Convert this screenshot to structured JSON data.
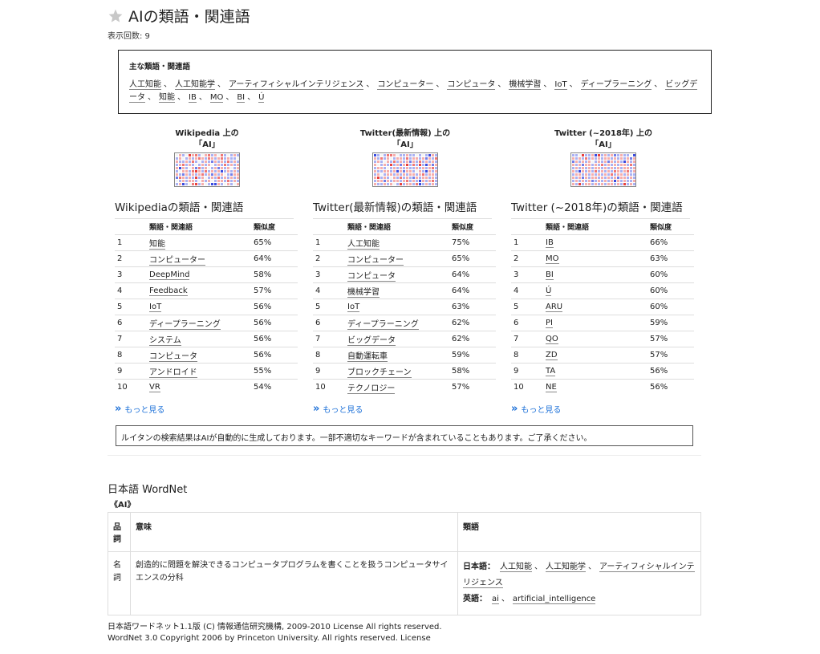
{
  "header": {
    "title": "AIの類語・関連語",
    "views_label": "表示回数: 9",
    "star_icon": "star-icon"
  },
  "main_synonyms": {
    "heading": "主な類語・関連語",
    "words": [
      "人工知能",
      "人工知能学",
      "アーティフィシャルインテリジェンス",
      "コンピューター",
      "コンピュータ",
      "機械学習",
      "IoT",
      "ディープラーニング",
      "ビッグデータ",
      "知能",
      "IB",
      "MO",
      "BI",
      "Ú"
    ],
    "separator": "、"
  },
  "sources": [
    {
      "label_line1": "Wikipedia 上の",
      "label_line2": "「AI」",
      "section_title": "Wikipediaの類語・関連語",
      "col_word": "類語・関連語",
      "col_sim": "類似度",
      "rows": [
        {
          "rank": "1",
          "word": "知能",
          "sim": "65%"
        },
        {
          "rank": "2",
          "word": "コンピューター",
          "sim": "64%"
        },
        {
          "rank": "3",
          "word": "DeepMind",
          "sim": "58%"
        },
        {
          "rank": "4",
          "word": "Feedback",
          "sim": "57%"
        },
        {
          "rank": "5",
          "word": "IoT",
          "sim": "56%"
        },
        {
          "rank": "6",
          "word": "ディープラーニング",
          "sim": "56%"
        },
        {
          "rank": "7",
          "word": "システム",
          "sim": "56%"
        },
        {
          "rank": "8",
          "word": "コンピュータ",
          "sim": "56%"
        },
        {
          "rank": "9",
          "word": "アンドロイド",
          "sim": "55%"
        },
        {
          "rank": "10",
          "word": "VR",
          "sim": "54%"
        }
      ],
      "more_label": "もっと見る",
      "heatmap": [
        [
          0,
          1,
          -1,
          0,
          3,
          1,
          2,
          -1,
          0,
          1,
          2,
          -1,
          1,
          0,
          2,
          -1,
          0,
          -1,
          1,
          -1
        ],
        [
          -1,
          1,
          0,
          -1,
          1,
          -1,
          1,
          2,
          1,
          -1,
          2,
          1,
          -1,
          1,
          2,
          -1,
          1,
          -1,
          -1,
          0
        ],
        [
          1,
          -1,
          -1,
          1,
          -1,
          2,
          -1,
          0,
          -1,
          1,
          -1,
          -2,
          1,
          -1,
          1,
          -1,
          2,
          -1,
          1,
          -1
        ],
        [
          -1,
          1,
          2,
          -1,
          1,
          -1,
          0,
          -1,
          1,
          -1,
          1,
          0,
          -1,
          1,
          -1,
          2,
          -1,
          1,
          -1,
          1
        ],
        [
          1,
          -3,
          1,
          -1,
          0,
          1,
          -2,
          2,
          -1,
          1,
          0,
          -1,
          1,
          -2,
          1,
          -1,
          1,
          0,
          -1,
          1
        ],
        [
          -1,
          0,
          1,
          1,
          -1,
          2,
          3,
          1,
          -1,
          2,
          -1,
          1,
          -1,
          1,
          -3,
          -1,
          1,
          -1,
          1,
          -1
        ],
        [
          1,
          -1,
          -2,
          1,
          -1,
          1,
          -1,
          1,
          2,
          -1,
          1,
          -2,
          1,
          -1,
          1,
          0,
          -1,
          -2,
          1,
          1
        ],
        [
          -2,
          2,
          1,
          -1,
          1,
          -1,
          3,
          -1,
          1,
          0,
          -1,
          1,
          -1,
          2,
          -1,
          1,
          -1,
          1,
          -1,
          1
        ],
        [
          0,
          -1,
          1,
          -1,
          1,
          1,
          -1,
          0,
          1,
          -1,
          1,
          0,
          -1,
          1,
          1,
          -1,
          2,
          -1,
          1,
          -1
        ],
        [
          -1,
          1,
          -3,
          -1,
          0,
          2,
          3,
          -1,
          1,
          0,
          -1,
          -3,
          -3,
          1,
          -1,
          0,
          1,
          -1,
          0,
          1
        ]
      ]
    },
    {
      "label_line1": "Twitter(最新情報) 上の",
      "label_line2": "「AI」",
      "section_title": "Twitter(最新情報)の類語・関連語",
      "col_word": "類語・関連語",
      "col_sim": "類似度",
      "rows": [
        {
          "rank": "1",
          "word": "人工知能",
          "sim": "75%"
        },
        {
          "rank": "2",
          "word": "コンピューター",
          "sim": "65%"
        },
        {
          "rank": "3",
          "word": "コンピュータ",
          "sim": "64%"
        },
        {
          "rank": "4",
          "word": "機械学習",
          "sim": "64%"
        },
        {
          "rank": "5",
          "word": "IoT",
          "sim": "63%"
        },
        {
          "rank": "6",
          "word": "ディープラーニング",
          "sim": "62%"
        },
        {
          "rank": "7",
          "word": "ビッグデータ",
          "sim": "62%"
        },
        {
          "rank": "8",
          "word": "自動運転車",
          "sim": "59%"
        },
        {
          "rank": "9",
          "word": "ブロックチェーン",
          "sim": "58%"
        },
        {
          "rank": "10",
          "word": "テクノロジー",
          "sim": "57%"
        }
      ],
      "more_label": "もっと見る",
      "heatmap": [
        [
          -3,
          -1,
          0,
          -1,
          2,
          2,
          1,
          0,
          -1,
          -1,
          1,
          -1,
          -1,
          0,
          -1,
          0,
          -1,
          -3,
          1,
          -1
        ],
        [
          1,
          -1,
          2,
          -1,
          1,
          0,
          -1,
          1,
          1,
          -1,
          2,
          -1,
          1,
          1,
          -1,
          1,
          -2,
          1,
          -1,
          2
        ],
        [
          -1,
          1,
          -1,
          0,
          1,
          -1,
          2,
          -1,
          1,
          -1,
          1,
          -2,
          1,
          -1,
          2,
          -1,
          1,
          -1,
          1,
          -1
        ],
        [
          1,
          0,
          -1,
          1,
          -1,
          3,
          -1,
          1,
          -2,
          1,
          3,
          -1,
          2,
          -1,
          3,
          -1,
          -3,
          1,
          -2,
          1
        ],
        [
          -1,
          1,
          1,
          -1,
          0,
          -1,
          1,
          -1,
          1,
          -1,
          1,
          -1,
          -1,
          1,
          -1,
          1,
          -1,
          1,
          2,
          -1
        ],
        [
          1,
          -1,
          -1,
          1,
          1,
          -1,
          1,
          -3,
          1,
          -2,
          1,
          1,
          -1,
          0,
          1,
          -1,
          -3,
          1,
          -1,
          1
        ],
        [
          -1,
          1,
          0,
          -1,
          1,
          1,
          -1,
          1,
          -1,
          1,
          -1,
          1,
          1,
          -1,
          1,
          2,
          -1,
          1,
          1,
          -1
        ],
        [
          1,
          3,
          -1,
          1,
          -1,
          0,
          1,
          -1,
          2,
          -1,
          1,
          -1,
          -2,
          1,
          -1,
          1,
          1,
          -1,
          1,
          -1
        ],
        [
          -1,
          1,
          1,
          -2,
          1,
          -1,
          1,
          1,
          -1,
          1,
          2,
          -1,
          1,
          -1,
          -3,
          1,
          -1,
          1,
          2,
          -1
        ],
        [
          1,
          -1,
          -1,
          1,
          -1,
          1,
          0,
          -1,
          3,
          -1,
          1,
          1,
          -1,
          2,
          -3,
          -1,
          1,
          -1,
          1,
          -1
        ]
      ]
    },
    {
      "label_line1": "Twitter (~2018年) 上の",
      "label_line2": "「AI」",
      "section_title": "Twitter (~2018年)の類語・関連語",
      "col_word": "類語・関連語",
      "col_sim": "類似度",
      "rows": [
        {
          "rank": "1",
          "word": "IB",
          "sim": "66%"
        },
        {
          "rank": "2",
          "word": "MO",
          "sim": "63%"
        },
        {
          "rank": "3",
          "word": "BI",
          "sim": "60%"
        },
        {
          "rank": "4",
          "word": "Ú",
          "sim": "60%"
        },
        {
          "rank": "5",
          "word": "ARU",
          "sim": "60%"
        },
        {
          "rank": "6",
          "word": "PI",
          "sim": "59%"
        },
        {
          "rank": "7",
          "word": "QO",
          "sim": "57%"
        },
        {
          "rank": "8",
          "word": "ZD",
          "sim": "57%"
        },
        {
          "rank": "9",
          "word": "TA",
          "sim": "56%"
        },
        {
          "rank": "10",
          "word": "NE",
          "sim": "56%"
        }
      ],
      "more_label": "もっと見る",
      "heatmap": [
        [
          -1,
          -1,
          0,
          3,
          -1,
          -1,
          1,
          -3,
          3,
          -1,
          1,
          -1,
          1,
          -2,
          -1,
          1,
          -1,
          -1,
          0,
          -3
        ],
        [
          1,
          -1,
          1,
          -1,
          2,
          -1,
          1,
          -1,
          1,
          -1,
          1,
          1,
          -1,
          1,
          -1,
          1,
          -1,
          1,
          -2,
          1
        ],
        [
          -2,
          1,
          -1,
          1,
          -1,
          1,
          0,
          -1,
          1,
          -1,
          1,
          -2,
          1,
          -1,
          1,
          -1,
          -3,
          1,
          -1,
          1
        ],
        [
          1,
          -1,
          1,
          -2,
          1,
          1,
          -1,
          1,
          -1,
          2,
          -1,
          1,
          -1,
          1,
          -1,
          1,
          1,
          -1,
          2,
          -1
        ],
        [
          -1,
          1,
          -1,
          1,
          -1,
          1,
          -1,
          1,
          1,
          -1,
          1,
          -1,
          1,
          -1,
          1,
          -1,
          1,
          1,
          -1,
          1
        ],
        [
          1,
          -1,
          -3,
          1,
          -1,
          1,
          -1,
          2,
          -1,
          1,
          -1,
          1,
          -1,
          2,
          1,
          -1,
          1,
          2,
          -1,
          1
        ],
        [
          -1,
          1,
          1,
          -1,
          1,
          -1,
          1,
          -1,
          1,
          -1,
          1,
          -1,
          2,
          -1,
          1,
          1,
          -1,
          1,
          -1,
          -1
        ],
        [
          1,
          -1,
          1,
          -2,
          1,
          -1,
          1,
          1,
          -1,
          1,
          -1,
          1,
          -1,
          1,
          -2,
          1,
          1,
          -1,
          1,
          -1
        ],
        [
          -1,
          1,
          -1,
          1,
          -1,
          1,
          -2,
          -1,
          1,
          -1,
          1,
          -1,
          1,
          -3,
          1,
          -1,
          1,
          -1,
          -1,
          1
        ],
        [
          1,
          -1,
          3,
          -1,
          1,
          1,
          -1,
          1,
          -1,
          1,
          -1,
          1,
          1,
          -1,
          1,
          -1,
          3,
          -1,
          1,
          -1
        ]
      ]
    }
  ],
  "notice": "ルイタンの検索結果はAIが自動的に生成しております。一部不適切なキーワードが含まれていることもあります。ご了承ください。",
  "wordnet": {
    "title": "日本語 WordNet",
    "word": "《AI》",
    "col_pos": "品詞",
    "col_meaning": "意味",
    "col_synonyms": "類語",
    "entries": [
      {
        "pos": "名詞",
        "meaning": "創造的に問題を解決できるコンピュータプログラムを書くことを扱うコンピュータサイエンスの分科",
        "ja_label": "日本語：",
        "ja_words": [
          "人工知能",
          "人工知能学",
          "アーティフィシャルインテリジェンス"
        ],
        "en_label": "英語：",
        "en_words": [
          "ai",
          "artificial_intelligence"
        ]
      }
    ]
  },
  "footer": {
    "line1": "日本語ワードネット1.1版 (C) 情報通信研究機構, 2009-2010 License All rights reserved.",
    "line2": "WordNet 3.0 Copyright 2006 by Princeton University. All rights reserved. License"
  },
  "colors": {
    "link_blue": "#1a6fd8",
    "heat_red": "#e8413f",
    "heat_blue": "#3a4be0"
  }
}
